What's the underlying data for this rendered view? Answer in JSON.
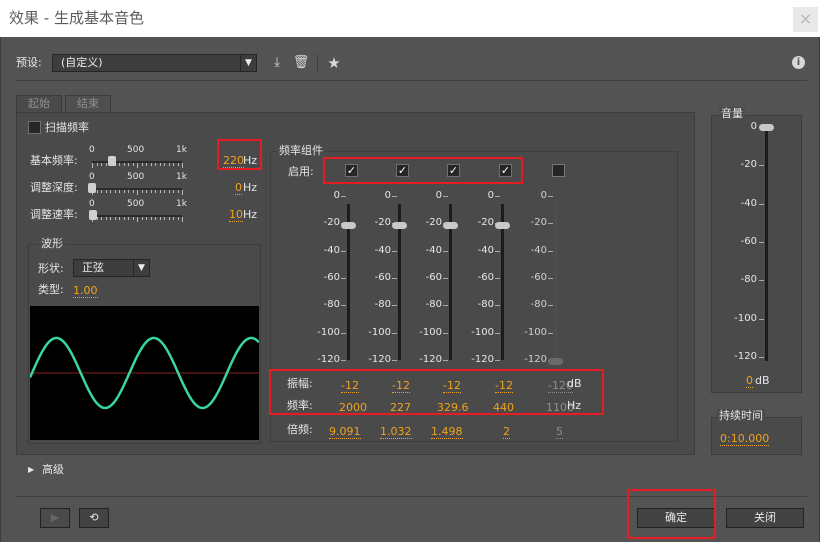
{
  "window": {
    "title": "效果 - 生成基本音色",
    "close_label": "×"
  },
  "preset": {
    "label": "预设:",
    "value": "(自定义)",
    "info": "i"
  },
  "tabs": [
    "起始",
    "结束"
  ],
  "sweep_label": "扫描频率",
  "params": [
    {
      "label": "基本频率:",
      "value": "220",
      "unit": "Hz",
      "slider": 0.22
    },
    {
      "label": "调整深度:",
      "value": "0",
      "unit": "Hz",
      "slider": 0.0
    },
    {
      "label": "调整速率:",
      "value": "10",
      "unit": "Hz",
      "slider": 0.01
    }
  ],
  "scale": [
    "0",
    "500",
    "1k"
  ],
  "waveform": {
    "group": "波形",
    "shape_label": "形状:",
    "shape_value": "正弦",
    "type_label": "类型:",
    "type_value": "1.00",
    "color": "#3ad6a0"
  },
  "components": {
    "group": "频率组件",
    "enable_label": "启用:",
    "ticks": [
      "0",
      "-20",
      "-40",
      "-60",
      "-80",
      "-100",
      "-120"
    ],
    "amp_label": "振幅:",
    "amp_unit": "dB",
    "freq_label": "频率:",
    "freq_unit": "Hz",
    "mult_label": "倍频:",
    "columns": [
      {
        "enabled": true,
        "amp": "-12",
        "freq": "2000",
        "mult": "9.091",
        "level": 0.1
      },
      {
        "enabled": true,
        "amp": "-12",
        "freq": "227",
        "mult": "1.032",
        "level": 0.1
      },
      {
        "enabled": true,
        "amp": "-12",
        "freq": "329.6",
        "mult": "1.498",
        "level": 0.1
      },
      {
        "enabled": true,
        "amp": "-12",
        "freq": "440",
        "mult": "2",
        "level": 0.1
      },
      {
        "enabled": false,
        "amp": "-120",
        "freq": "1100",
        "mult": "5",
        "level": 1.0
      }
    ]
  },
  "volume": {
    "label": "音量",
    "ticks": [
      "0",
      "-20",
      "-40",
      "-60",
      "-80",
      "-100",
      "-120"
    ],
    "value": "0",
    "unit": "dB",
    "level": 0.0
  },
  "duration": {
    "label": "持续时间",
    "value": "0:10.000"
  },
  "advanced_label": "高级",
  "buttons": {
    "ok": "确定",
    "close": "关闭",
    "play": "▶",
    "loop": "⟲"
  }
}
